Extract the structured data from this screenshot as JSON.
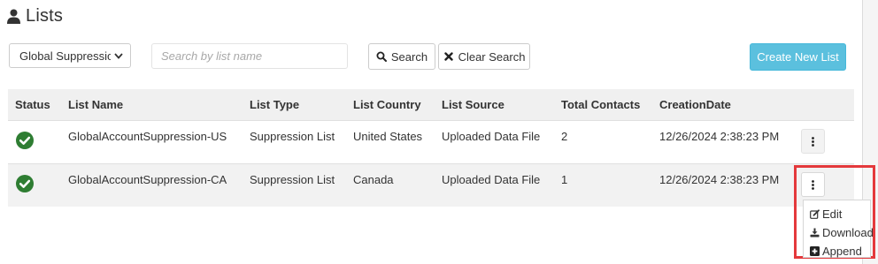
{
  "page": {
    "title": "Lists"
  },
  "toolbar": {
    "filter_value": "Global Suppressior",
    "search_placeholder": "Search by list name",
    "search_label": "Search",
    "clear_label": "Clear Search",
    "create_label": "Create New List"
  },
  "table": {
    "columns": [
      "Status",
      "List Name",
      "List Type",
      "List Country",
      "List Source",
      "Total Contacts",
      "CreationDate"
    ],
    "rows": [
      {
        "status": "active",
        "name": "GlobalAccountSuppression-US",
        "type": "Suppression List",
        "country": "United States",
        "source": "Uploaded Data File",
        "contacts": "2",
        "created": "12/26/2024 2:38:23 PM"
      },
      {
        "status": "active",
        "name": "GlobalAccountSuppression-CA",
        "type": "Suppression List",
        "country": "Canada",
        "source": "Uploaded Data File",
        "contacts": "1",
        "created": "12/26/2024 2:38:23 PM"
      }
    ]
  },
  "action_menu": {
    "items": [
      {
        "label": "Edit",
        "icon": "edit-icon"
      },
      {
        "label": "Download",
        "icon": "download-icon"
      },
      {
        "label": "Append",
        "icon": "plus-square-icon"
      }
    ]
  },
  "colors": {
    "accent": "#5bc0de",
    "status_ok": "#2e7d32",
    "highlight": "#e4393c",
    "header_bg": "#f0f0f0"
  },
  "icons": {
    "title": "user-icon",
    "search": "magnifier-icon",
    "clear": "x-icon",
    "row_status": "check-circle-icon",
    "row_action": "kebab-icon"
  }
}
